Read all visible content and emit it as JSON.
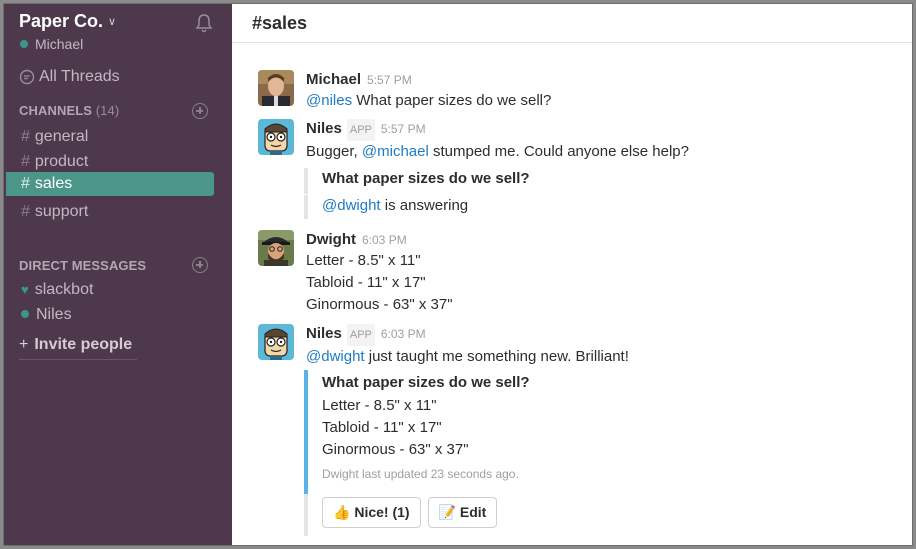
{
  "sidebar": {
    "team_name": "Paper Co.",
    "user_name": "Michael",
    "all_threads": "All Threads",
    "channels_label": "CHANNELS",
    "channels_count": "(14)",
    "channels": [
      {
        "name": "general",
        "active": false
      },
      {
        "name": "product",
        "active": false
      },
      {
        "name": "sales",
        "active": true
      },
      {
        "name": "support",
        "active": false
      }
    ],
    "dm_label": "DIRECT MESSAGES",
    "dms": [
      {
        "name": "slackbot",
        "icon": "heart-icon"
      },
      {
        "name": "Niles",
        "icon": "online-dot"
      }
    ],
    "invite": "Invite people"
  },
  "header": {
    "title": "#sales"
  },
  "messages": {
    "m1": {
      "author": "Michael",
      "time": "5:57 PM",
      "mention": "@niles",
      "text": " What paper sizes do we sell?"
    },
    "m2": {
      "author": "Niles",
      "badge": "APP",
      "time": "5:57 PM",
      "pre": "Bugger, ",
      "mention": "@michael",
      "post": " stumped me. Could anyone else help?",
      "attach_title": "What paper sizes do we sell?",
      "answer_mention": "@dwight",
      "answer_text": " is answering"
    },
    "m3": {
      "author": "Dwight",
      "time": "6:03 PM",
      "lines": [
        "Letter - 8.5\" x 11\"",
        "Tabloid - 11\" x 17\"",
        "Ginormous - 63\" x 37\""
      ]
    },
    "m4": {
      "author": "Niles",
      "badge": "APP",
      "time": "6:03 PM",
      "mention": "@dwight",
      "post": " just taught me something new. Brilliant!",
      "attach_title": "What paper sizes do we sell?",
      "lines": [
        "Letter - 8.5\" x 11\"",
        "Tabloid - 11\" x 17\"",
        "Ginormous - 63\" x 37\""
      ],
      "footer": "Dwight last updated 23 seconds ago.",
      "btn_nice": "Nice! (1)",
      "btn_edit": "Edit"
    }
  },
  "colors": {
    "sidebar_bg": "#4d394b",
    "active_channel": "#4c9689",
    "mention": "#1f7bc1",
    "attach_accent": "#5ab3e8"
  }
}
